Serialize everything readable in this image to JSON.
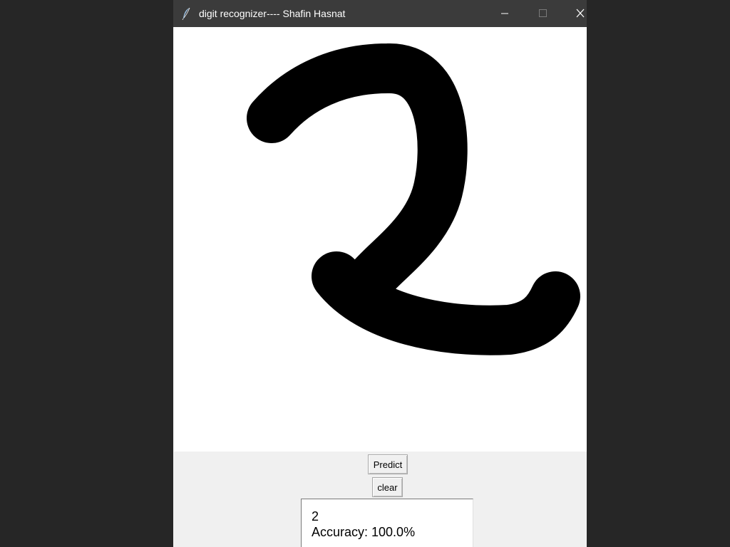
{
  "window": {
    "title": "digit recognizer---- Shafin Hasnat",
    "app_icon": "feather-icon",
    "controls": [
      "minimize-icon",
      "maximize-icon",
      "close-icon"
    ]
  },
  "canvas": {
    "background": "#ffffff",
    "stroke_color": "#000000",
    "drawn_digit": "2"
  },
  "buttons": {
    "predict_label": "Predict",
    "clear_label": "clear"
  },
  "result": {
    "digit": "2",
    "accuracy": "Accuracy: 100.0%"
  },
  "colors": {
    "desktop": "#262626",
    "titlebar": "#3b3b3b",
    "window_bg": "#f0f0f0"
  }
}
